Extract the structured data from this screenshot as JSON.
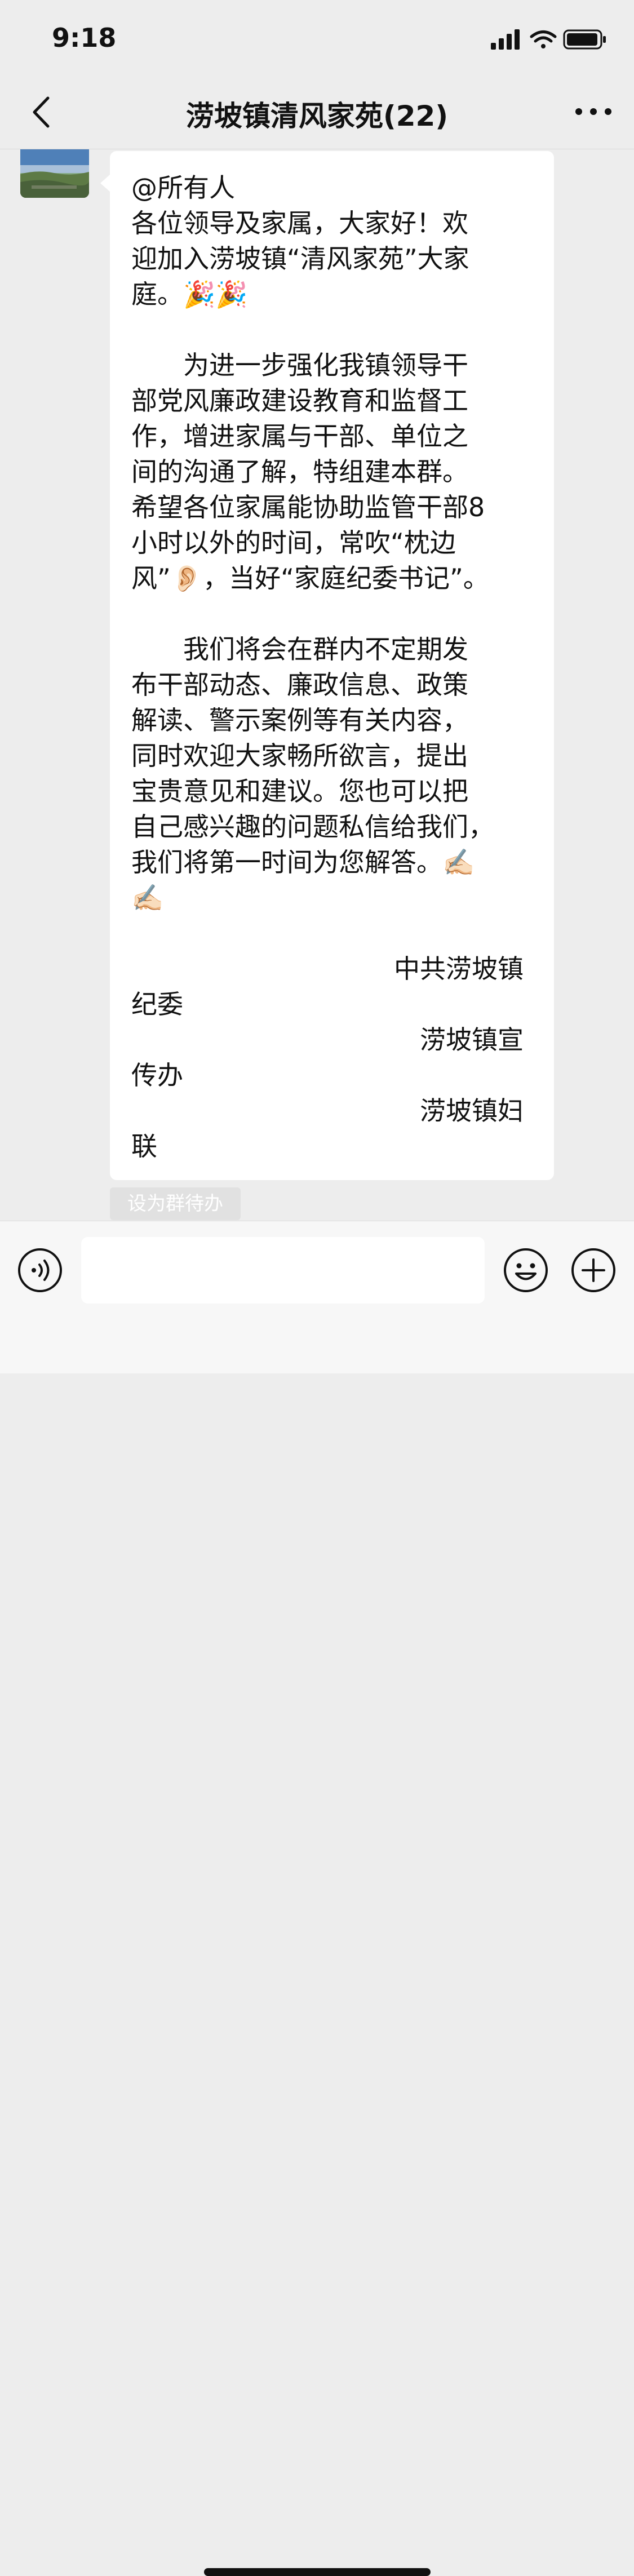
{
  "status_bar": {
    "time": "9:18"
  },
  "nav": {
    "title": "涝坡镇清风家苑(22)"
  },
  "message": {
    "lines": [
      "@所有人",
      "各位领导及家属，大家好！欢",
      "迎加入涝坡镇“清风家苑”大家",
      "庭。🎉🎉",
      "",
      "　　为进一步强化我镇领导干",
      "部党风廉政建设教育和监督工",
      "作，增进家属与干部、单位之",
      "间的沟通了解，特组建本群。",
      "希望各位家属能协助监管干部8",
      "小时以外的时间，常吹“枕边",
      "风”👂🏻，当好“家庭纪委书记”。",
      "",
      "　　我们将会在群内不定期发",
      "布干部动态、廉政信息、政策",
      "解读、警示案例等有关内容，",
      "同时欢迎大家畅所欲言，提出",
      "宝贵意见和建议。您也可以把",
      "自己感兴趣的问题私信给我们，",
      "我们将第一时间为您解答。✍🏻",
      "✍🏻",
      "",
      "中共涝坡镇",
      "纪委",
      "涝坡镇宣",
      "传办",
      "涝坡镇妇",
      "联"
    ]
  },
  "todo_chip": {
    "label": "设为群待办"
  },
  "input": {
    "value": ""
  },
  "icons": {
    "back": "chevron-left-icon",
    "more": "more-dots-icon",
    "voice": "voice-icon",
    "emoji": "smiley-icon",
    "plus": "plus-icon",
    "signal": "signal-icon",
    "wifi": "wifi-icon",
    "battery": "battery-icon"
  }
}
